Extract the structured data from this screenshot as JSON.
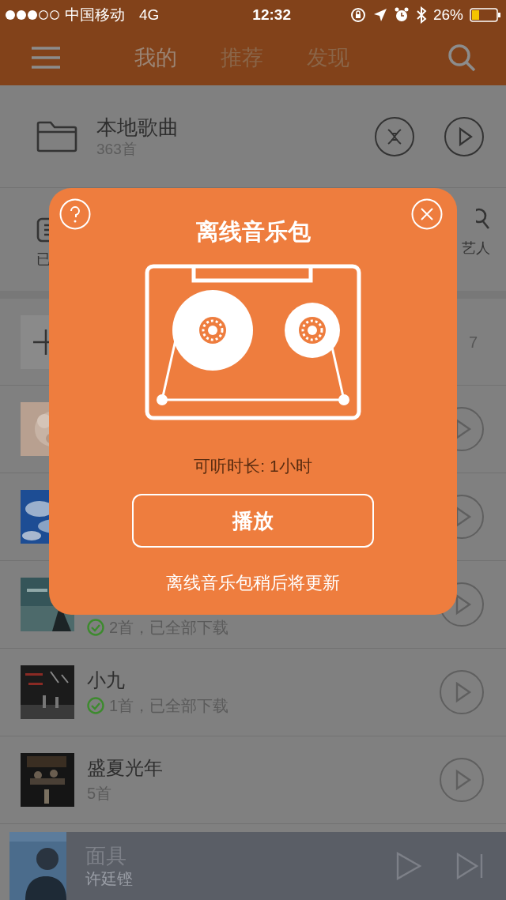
{
  "status_bar": {
    "carrier": "中国移动",
    "network": "4G",
    "time": "12:32",
    "battery": "26%"
  },
  "nav": {
    "tabs": [
      {
        "label": "我的",
        "selected": true
      },
      {
        "label": "推荐",
        "selected": false
      },
      {
        "label": "发现",
        "selected": false
      }
    ]
  },
  "local_music": {
    "title": "本地歌曲",
    "count": "363首"
  },
  "shortcuts": [
    {
      "label": "已"
    },
    {
      "label": "艺人"
    }
  ],
  "create_row": {
    "count": "7"
  },
  "playlists": [
    {
      "kind": "picture"
    },
    {
      "kind": "picture"
    },
    {
      "kind": "picture",
      "subtitle": "2首，已全部下载",
      "downloaded": true
    },
    {
      "kind": "picture",
      "title": "小九",
      "subtitle": "1首，已全部下载",
      "downloaded": true
    },
    {
      "kind": "picture",
      "title": "盛夏光年",
      "subtitle": "5首"
    }
  ],
  "player": {
    "title": "面具",
    "artist": "许廷铿"
  },
  "dialog": {
    "title": "离线音乐包",
    "duration": "可听时长: 1小时",
    "button": "播放",
    "note": "离线音乐包稍后将更新"
  }
}
